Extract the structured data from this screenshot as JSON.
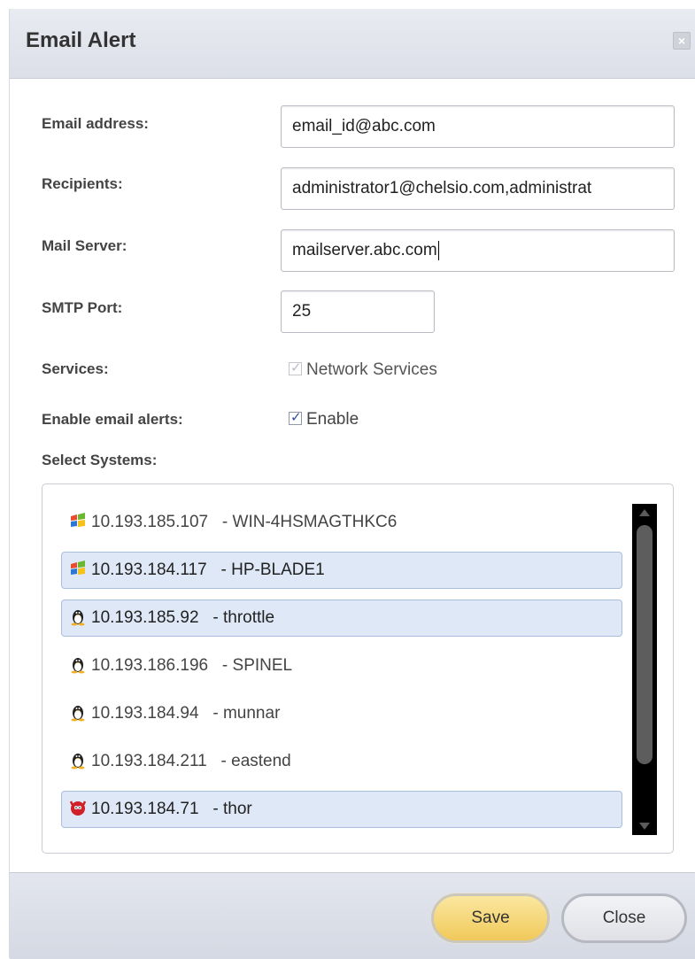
{
  "dialog": {
    "title": "Email Alert",
    "close_glyph": "×"
  },
  "form": {
    "email_label": "Email address:",
    "email_value": "email_id@abc.com",
    "recipients_label": "Recipients:",
    "recipients_value": "administrator1@chelsio.com,administrat",
    "mail_server_label": "Mail Server:",
    "mail_server_value": "mailserver.abc.com",
    "smtp_port_label": "SMTP Port:",
    "smtp_port_value": "25",
    "services_label": "Services:",
    "services_option": "Network Services",
    "enable_label": "Enable email alerts:",
    "enable_option": "Enable",
    "select_systems_label": "Select Systems:"
  },
  "systems": [
    {
      "ip": "10.193.185.107",
      "name": "WIN-4HSMAGTHKC6",
      "os_icon": "windows-icon",
      "selected": false
    },
    {
      "ip": "10.193.184.117",
      "name": "HP-BLADE1",
      "os_icon": "windows-icon",
      "selected": true
    },
    {
      "ip": "10.193.185.92",
      "name": "throttle",
      "os_icon": "linux-icon",
      "selected": true
    },
    {
      "ip": "10.193.186.196",
      "name": "SPINEL",
      "os_icon": "linux-icon",
      "selected": false
    },
    {
      "ip": "10.193.184.94",
      "name": "munnar",
      "os_icon": "linux-icon",
      "selected": false
    },
    {
      "ip": "10.193.184.211",
      "name": "eastend",
      "os_icon": "linux-icon",
      "selected": false
    },
    {
      "ip": "10.193.184.71",
      "name": "thor",
      "os_icon": "freebsd-icon",
      "selected": true
    }
  ],
  "system_separator": " - ",
  "footer": {
    "save_label": "Save",
    "close_label": "Close"
  },
  "colors": {
    "selected_row_bg": "#dfe8f6",
    "save_button": "#f0c95a"
  }
}
